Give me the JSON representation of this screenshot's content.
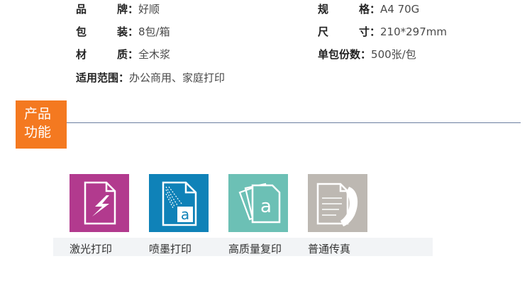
{
  "specs": [
    {
      "label_chars": [
        "品",
        "牌"
      ],
      "value": "好顺"
    },
    {
      "label_chars": [
        "规",
        "格"
      ],
      "value": "A4 70G"
    },
    {
      "label_chars": [
        "包",
        "装"
      ],
      "value": "8包/箱"
    },
    {
      "label_chars": [
        "尺",
        "寸"
      ],
      "value": "210*297mm"
    },
    {
      "label_chars": [
        "材",
        "质"
      ],
      "value": "全木浆"
    },
    {
      "label": "单包份数",
      "value": "500张/包"
    },
    {
      "label": "适用范围",
      "value": "办公商用、家庭打印"
    }
  ],
  "colon": "：",
  "section": {
    "line1": "产品",
    "line2": "功能",
    "color": "#f47920"
  },
  "features": [
    {
      "label": "激光打印",
      "icon": "laser-print-icon",
      "color": "#b23a8e"
    },
    {
      "label": "喷墨打印",
      "icon": "inkjet-print-icon",
      "color": "#0f82b8"
    },
    {
      "label": "高质量复印",
      "icon": "copy-icon",
      "color": "#6cc0b5"
    },
    {
      "label": "普通传真",
      "icon": "fax-icon",
      "color": "#bdb8b2"
    }
  ]
}
